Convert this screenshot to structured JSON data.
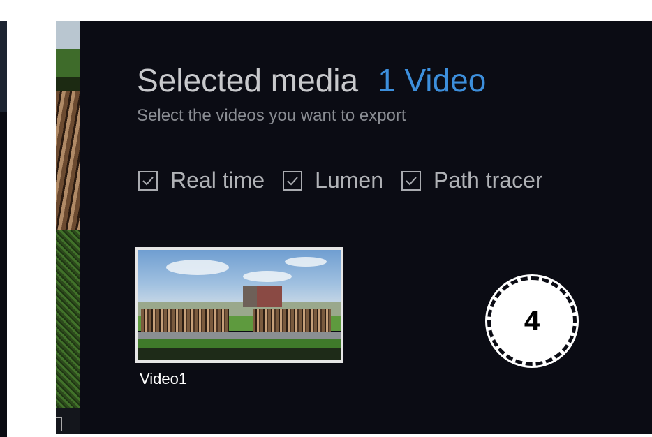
{
  "header": {
    "title": "Selected media",
    "count": "1 Video",
    "subtitle": "Select the videos you want to export"
  },
  "filters": [
    {
      "label": "Real time",
      "checked": true
    },
    {
      "label": "Lumen",
      "checked": true
    },
    {
      "label": "Path tracer",
      "checked": true
    }
  ],
  "media": [
    {
      "name": "Video1",
      "selected": true
    }
  ],
  "step_badge": "4",
  "colors": {
    "panel_bg": "#0b0c14",
    "accent": "#3d8fdc",
    "title": "#c8c9cc",
    "muted": "#8a8d93"
  }
}
